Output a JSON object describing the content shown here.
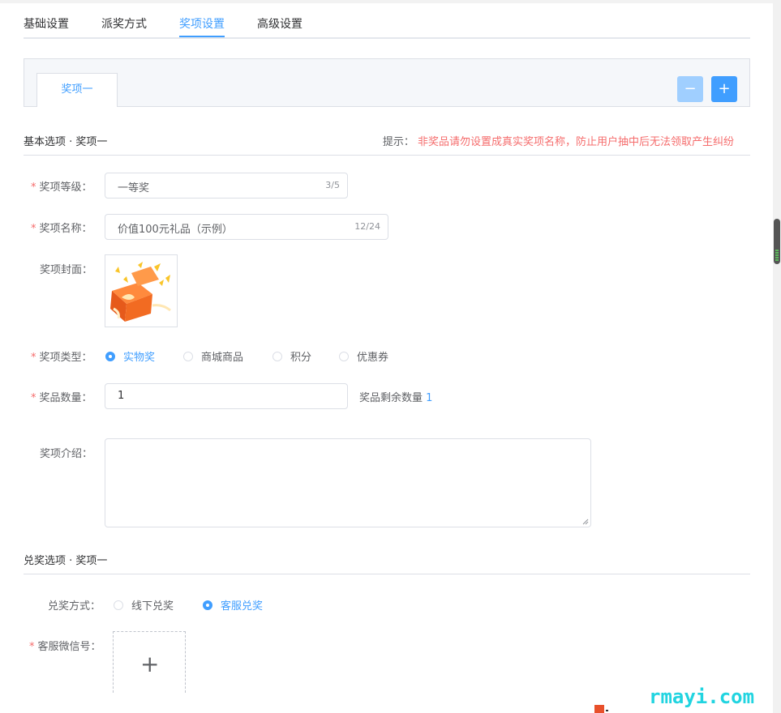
{
  "tabs": {
    "items": [
      {
        "label": "基础设置"
      },
      {
        "label": "派奖方式"
      },
      {
        "label": "奖项设置",
        "active": true
      },
      {
        "label": "高级设置"
      }
    ]
  },
  "prize_tabs": {
    "items": [
      {
        "label": "奖项一"
      }
    ],
    "minus_icon": "minus-icon",
    "plus_icon": "plus-icon"
  },
  "basic_section": {
    "title": "基本选项 · 奖项一",
    "hint_label": "提示：",
    "hint_text": "非奖品请勿设置成真实奖项名称，防止用户抽中后无法领取产生纠纷"
  },
  "form": {
    "level": {
      "required_mark": "*",
      "label": "奖项等级：",
      "value": "一等奖",
      "count": "3/5"
    },
    "name": {
      "required_mark": "*",
      "label": "奖项名称：",
      "value": "价值100元礼品（示例）",
      "count": "12/24"
    },
    "cover": {
      "label": "奖项封面：",
      "image": "gift-box-image"
    },
    "type": {
      "required_mark": "*",
      "label": "奖项类型：",
      "options": [
        {
          "label": "实物奖",
          "checked": true
        },
        {
          "label": "商城商品",
          "checked": false
        },
        {
          "label": "积分",
          "checked": false
        },
        {
          "label": "优惠券",
          "checked": false
        }
      ]
    },
    "quantity": {
      "required_mark": "*",
      "label": "奖品数量：",
      "value": "1",
      "remaining_label": "奖品剩余数量",
      "remaining_value": "1"
    },
    "intro": {
      "label": "奖项介绍：",
      "value": ""
    }
  },
  "redeem_section": {
    "title": "兑奖选项 · 奖项一",
    "method": {
      "label": "兑奖方式：",
      "options": [
        {
          "label": "线下兑奖",
          "checked": false
        },
        {
          "label": "客服兑奖",
          "checked": true
        }
      ]
    },
    "wechat": {
      "required_mark": "*",
      "label": "客服微信号：",
      "upload_icon": "plus-icon"
    }
  },
  "watermark": "rmayi.com",
  "colors": {
    "accent": "#409eff",
    "accent_light": "#a0cfff",
    "danger": "#f56c6c",
    "watermark": "#21d4e0"
  }
}
